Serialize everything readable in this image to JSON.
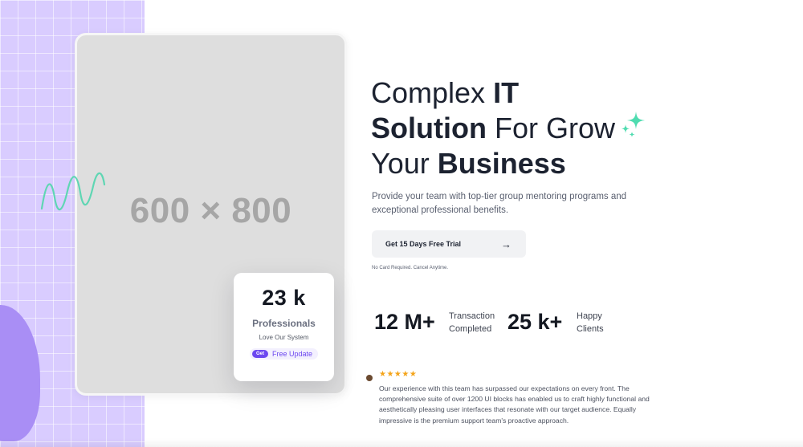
{
  "image_placeholder": {
    "label": "600 × 800"
  },
  "stats_card": {
    "number": "23 k",
    "title": "Professionals",
    "subtitle": "Love Our System",
    "badge_tag": "Get",
    "badge_text": "Free Update"
  },
  "hero": {
    "line1_regular": "Complex ",
    "line1_bold": "IT",
    "line2_bold": "Solution",
    "line2_regular": " For Grow",
    "line3_regular": "Your ",
    "line3_bold": "Business"
  },
  "description": "Provide your team with top-tier group mentoring programs and exceptional professional benefits.",
  "cta": {
    "label": "Get 15 Days Free Trial",
    "arrow_icon": "arrow-right-icon"
  },
  "note": "No Card Required. Cancel Anytime.",
  "stats": [
    {
      "value": "12 M+",
      "label_line1": "Transaction",
      "label_line2": "Completed"
    },
    {
      "value": "25 k+",
      "label_line1": "Happy",
      "label_line2": "Clients"
    }
  ],
  "review": {
    "stars": "★★★★★",
    "text": "Our experience with this team has surpassed our expectations on every front. The comprehensive suite of over 1200 UI blocks has enabled us to craft highly functional and aesthetically pleasing user interfaces that resonate with our target audience. Equally impressive is the premium support team's proactive approach."
  },
  "colors": {
    "accent_purple": "#6c47f0",
    "panel_lavender": "#d9ccff",
    "sparkle_green": "#4fdcb0",
    "star_orange": "#f4a41a"
  }
}
